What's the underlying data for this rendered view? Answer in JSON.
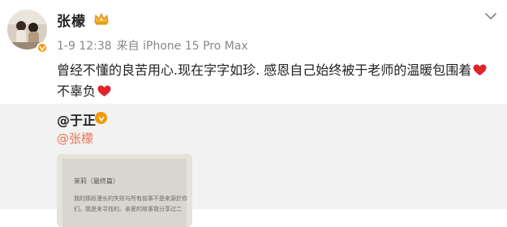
{
  "post": {
    "author_name": "张檬",
    "timestamp": "1-9 12:38",
    "source": "来自 iPhone 15 Pro Max",
    "text_part1": "曾经不懂的良苦用心.现在字字如珍. 感恩自己始终被于老师的温暖包围着",
    "text_part2": " 不辜负",
    "icons": {
      "avatar": "avatar",
      "verified": "verified-badge-icon",
      "crown": "crown-icon",
      "menu": "chevron-down-icon",
      "heart": "red-heart-icon"
    }
  },
  "repost": {
    "author": "@于正",
    "mention": "@张檬",
    "image_title": "茉莉（最终篇）",
    "image_lines": [
      "我的那段漫长的失败与所有前事不是来源於你",
      "们。我是来寻找的。亲爱的故事我分享过二"
    ]
  },
  "colors": {
    "verified": "#f39800",
    "mention": "#eb7350",
    "heart": "#e0242b",
    "repost_bg": "#f2f2f2"
  }
}
